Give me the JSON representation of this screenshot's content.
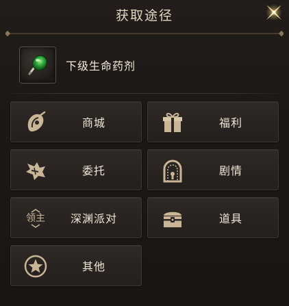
{
  "window": {
    "title": "获取途径",
    "close_icon": "close-x-icon"
  },
  "item": {
    "name": "下级生命药剂",
    "icon": "green-potion-icon"
  },
  "sources": [
    {
      "label": "商城",
      "icon": "shop-icon"
    },
    {
      "label": "福利",
      "icon": "gift-icon"
    },
    {
      "label": "委托",
      "icon": "commission-icon"
    },
    {
      "label": "剧情",
      "icon": "story-gate-icon"
    },
    {
      "label": "深渊派对",
      "icon": "boss-lord-icon",
      "icon_text": "领主"
    },
    {
      "label": "道具",
      "icon": "treasure-chest-icon"
    },
    {
      "label": "其他",
      "icon": "star-icon"
    }
  ],
  "colors": {
    "background": "#1c1815",
    "button": "#2b2622",
    "text": "#eee6d6",
    "icon_tan": "#c9b697",
    "potion_green": "#2fa83a",
    "close_gold": "#e6c77a"
  }
}
